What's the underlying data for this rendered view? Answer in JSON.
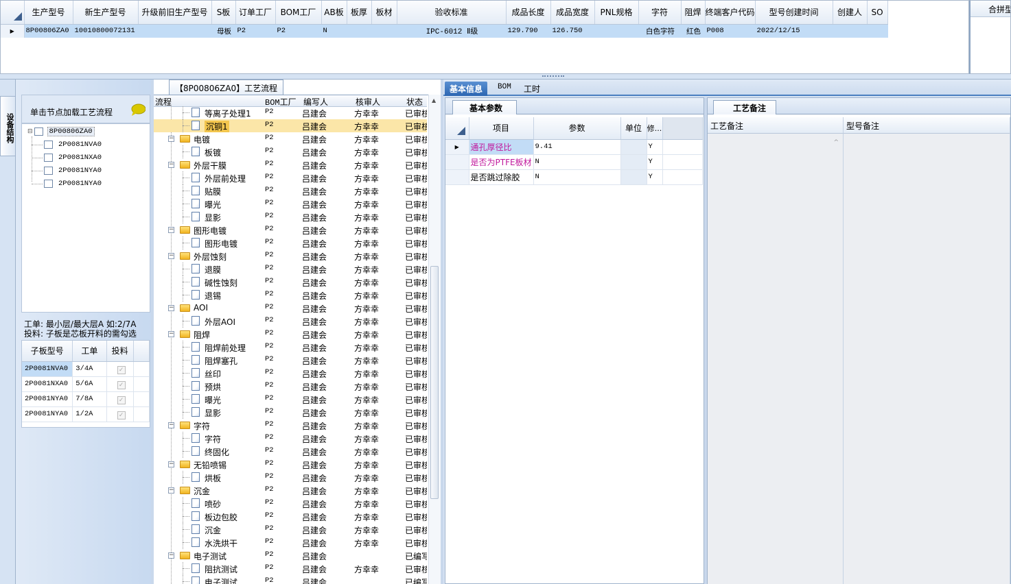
{
  "top_grid": {
    "columns": [
      "生产型号",
      "新生产型号",
      "升级前旧生产型号",
      "S板",
      "订单工厂",
      "BOM工厂",
      "AB板",
      "板厚",
      "板材",
      "验收标准",
      "成品长度",
      "成品宽度",
      "PNL规格",
      "字符",
      "阻焊",
      "终端客户代码",
      "型号创建时间",
      "创建人",
      "SO"
    ],
    "row": [
      "8P00806ZA0",
      "10010800072131",
      "",
      "母板",
      "P2",
      "P2",
      "N",
      "",
      "",
      "IPC-6012 Ⅱ级",
      "129.790",
      "126.750",
      "",
      "白色字符",
      "红色",
      "P008",
      "2022/12/15",
      "",
      ""
    ],
    "row_marker": "▶"
  },
  "top_right": {
    "header": "合拼型"
  },
  "left_panel": {
    "vertical_tab": "设备结构",
    "load_hint": "单击节点加载工艺流程",
    "tree": {
      "root": "8P00806ZA0",
      "children": [
        "2P0081NVA0",
        "2P0081NXA0",
        "2P0081NYA0",
        "2P0081NYA0"
      ]
    },
    "note_line1": "工单: 最小层/最大层A 如:2/7A",
    "note_line2": "投料: 子板是芯板开料的需勾选",
    "subgrid": {
      "columns": [
        "子板型号",
        "工单",
        "投料"
      ],
      "rows": [
        {
          "model": "2P0081NVA0",
          "order": "3/4A",
          "check": "✓"
        },
        {
          "model": "2P0081NXA0",
          "order": "5/6A",
          "check": "✓"
        },
        {
          "model": "2P0081NYA0",
          "order": "7/8A",
          "check": "✓"
        },
        {
          "model": "2P0081NYA0",
          "order": "1/2A",
          "check": "✓"
        }
      ]
    }
  },
  "process": {
    "tab_title": "【8P00806ZA0】工艺流程",
    "columns": [
      "流程",
      "BOM工厂",
      "编写人",
      "核审人",
      "状态"
    ],
    "rows": [
      {
        "name": "等离子处理1",
        "level": 2,
        "type": "item",
        "bom": "P2",
        "writer": "吕建会",
        "reviewer": "方幸幸",
        "status": "已审核"
      },
      {
        "name": "沉铜1",
        "level": 2,
        "type": "item",
        "bom": "P2",
        "writer": "吕建会",
        "reviewer": "方幸幸",
        "status": "已审核",
        "selected": true
      },
      {
        "name": "电镀",
        "level": 1,
        "type": "folder",
        "bom": "P2",
        "writer": "吕建会",
        "reviewer": "方幸幸",
        "status": "已审核"
      },
      {
        "name": "板镀",
        "level": 2,
        "type": "item",
        "bom": "P2",
        "writer": "吕建会",
        "reviewer": "方幸幸",
        "status": "已审核"
      },
      {
        "name": "外层干膜",
        "level": 1,
        "type": "folder",
        "bom": "P2",
        "writer": "吕建会",
        "reviewer": "方幸幸",
        "status": "已审核"
      },
      {
        "name": "外层前处理",
        "level": 2,
        "type": "item",
        "bom": "P2",
        "writer": "吕建会",
        "reviewer": "方幸幸",
        "status": "已审核"
      },
      {
        "name": "贴膜",
        "level": 2,
        "type": "item",
        "bom": "P2",
        "writer": "吕建会",
        "reviewer": "方幸幸",
        "status": "已审核"
      },
      {
        "name": "曝光",
        "level": 2,
        "type": "item",
        "bom": "P2",
        "writer": "吕建会",
        "reviewer": "方幸幸",
        "status": "已审核"
      },
      {
        "name": "显影",
        "level": 2,
        "type": "item",
        "bom": "P2",
        "writer": "吕建会",
        "reviewer": "方幸幸",
        "status": "已审核"
      },
      {
        "name": "图形电镀",
        "level": 1,
        "type": "folder",
        "bom": "P2",
        "writer": "吕建会",
        "reviewer": "方幸幸",
        "status": "已审核"
      },
      {
        "name": "图形电镀",
        "level": 2,
        "type": "item",
        "bom": "P2",
        "writer": "吕建会",
        "reviewer": "方幸幸",
        "status": "已审核"
      },
      {
        "name": "外层蚀刻",
        "level": 1,
        "type": "folder",
        "bom": "P2",
        "writer": "吕建会",
        "reviewer": "方幸幸",
        "status": "已审核"
      },
      {
        "name": "退膜",
        "level": 2,
        "type": "item",
        "bom": "P2",
        "writer": "吕建会",
        "reviewer": "方幸幸",
        "status": "已审核"
      },
      {
        "name": "碱性蚀刻",
        "level": 2,
        "type": "item",
        "bom": "P2",
        "writer": "吕建会",
        "reviewer": "方幸幸",
        "status": "已审核"
      },
      {
        "name": "退锡",
        "level": 2,
        "type": "item",
        "bom": "P2",
        "writer": "吕建会",
        "reviewer": "方幸幸",
        "status": "已审核"
      },
      {
        "name": "AOI",
        "level": 1,
        "type": "folder",
        "bom": "P2",
        "writer": "吕建会",
        "reviewer": "方幸幸",
        "status": "已审核"
      },
      {
        "name": "外层AOI",
        "level": 2,
        "type": "item",
        "bom": "P2",
        "writer": "吕建会",
        "reviewer": "方幸幸",
        "status": "已审核"
      },
      {
        "name": "阻焊",
        "level": 1,
        "type": "folder",
        "bom": "P2",
        "writer": "吕建会",
        "reviewer": "方幸幸",
        "status": "已审核"
      },
      {
        "name": "阻焊前处理",
        "level": 2,
        "type": "item",
        "bom": "P2",
        "writer": "吕建会",
        "reviewer": "方幸幸",
        "status": "已审核"
      },
      {
        "name": "阻焊塞孔",
        "level": 2,
        "type": "item",
        "bom": "P2",
        "writer": "吕建会",
        "reviewer": "方幸幸",
        "status": "已审核"
      },
      {
        "name": "丝印",
        "level": 2,
        "type": "item",
        "bom": "P2",
        "writer": "吕建会",
        "reviewer": "方幸幸",
        "status": "已审核"
      },
      {
        "name": "预烘",
        "level": 2,
        "type": "item",
        "bom": "P2",
        "writer": "吕建会",
        "reviewer": "方幸幸",
        "status": "已审核"
      },
      {
        "name": "曝光",
        "level": 2,
        "type": "item",
        "bom": "P2",
        "writer": "吕建会",
        "reviewer": "方幸幸",
        "status": "已审核"
      },
      {
        "name": "显影",
        "level": 2,
        "type": "item",
        "bom": "P2",
        "writer": "吕建会",
        "reviewer": "方幸幸",
        "status": "已审核"
      },
      {
        "name": "字符",
        "level": 1,
        "type": "folder",
        "bom": "P2",
        "writer": "吕建会",
        "reviewer": "方幸幸",
        "status": "已审核"
      },
      {
        "name": "字符",
        "level": 2,
        "type": "item",
        "bom": "P2",
        "writer": "吕建会",
        "reviewer": "方幸幸",
        "status": "已审核"
      },
      {
        "name": "终固化",
        "level": 2,
        "type": "item",
        "bom": "P2",
        "writer": "吕建会",
        "reviewer": "方幸幸",
        "status": "已审核"
      },
      {
        "name": "无铅喷锡",
        "level": 1,
        "type": "folder",
        "bom": "P2",
        "writer": "吕建会",
        "reviewer": "方幸幸",
        "status": "已审核"
      },
      {
        "name": "烘板",
        "level": 2,
        "type": "item",
        "bom": "P2",
        "writer": "吕建会",
        "reviewer": "方幸幸",
        "status": "已审核"
      },
      {
        "name": "沉金",
        "level": 1,
        "type": "folder",
        "bom": "P2",
        "writer": "吕建会",
        "reviewer": "方幸幸",
        "status": "已审核"
      },
      {
        "name": "喷砂",
        "level": 2,
        "type": "item",
        "bom": "P2",
        "writer": "吕建会",
        "reviewer": "方幸幸",
        "status": "已审核"
      },
      {
        "name": "板边包胶",
        "level": 2,
        "type": "item",
        "bom": "P2",
        "writer": "吕建会",
        "reviewer": "方幸幸",
        "status": "已审核"
      },
      {
        "name": "沉金",
        "level": 2,
        "type": "item",
        "bom": "P2",
        "writer": "吕建会",
        "reviewer": "方幸幸",
        "status": "已审核"
      },
      {
        "name": "水洗烘干",
        "level": 2,
        "type": "item",
        "bom": "P2",
        "writer": "吕建会",
        "reviewer": "方幸幸",
        "status": "已审核"
      },
      {
        "name": "电子测试",
        "level": 1,
        "type": "folder",
        "bom": "P2",
        "writer": "吕建会",
        "reviewer": "",
        "status": "已编写"
      },
      {
        "name": "阻抗测试",
        "level": 2,
        "type": "item",
        "bom": "P2",
        "writer": "吕建会",
        "reviewer": "方幸幸",
        "status": "已审核"
      },
      {
        "name": "电子测试",
        "level": 2,
        "type": "item",
        "bom": "P2",
        "writer": "吕建会",
        "reviewer": "",
        "status": "已编写"
      }
    ]
  },
  "right_tabs": [
    "基本信息",
    "BOM",
    "工时"
  ],
  "basic_params": {
    "tab": "基本参数",
    "columns": [
      "项目",
      "参数",
      "单位",
      "修..."
    ],
    "rows": [
      {
        "item": "通孔厚径比",
        "value": "9.41",
        "unit": "",
        "mod": "Y",
        "color": "#c0179c",
        "selected": true
      },
      {
        "item": "是否为PTFE板材",
        "value": "N",
        "unit": "",
        "mod": "Y",
        "color": "#c0179c"
      },
      {
        "item": "是否跳过除胶",
        "value": "N",
        "unit": "",
        "mod": "Y",
        "color": "#000000"
      }
    ]
  },
  "remarks": {
    "tab": "工艺备注",
    "col1": "工艺备注",
    "col2": "型号备注"
  }
}
